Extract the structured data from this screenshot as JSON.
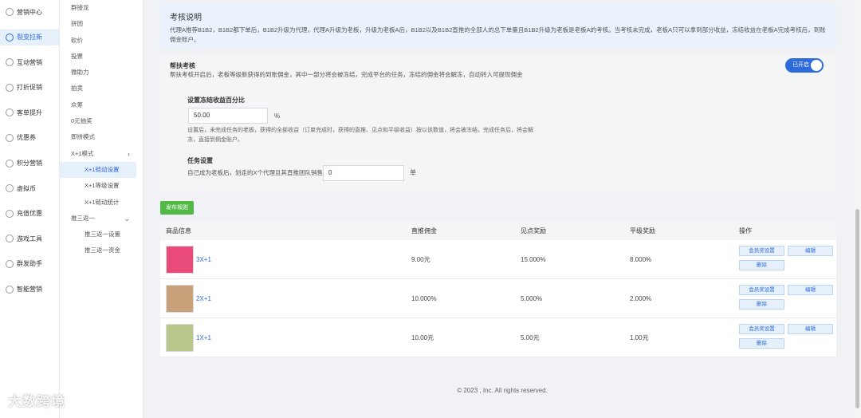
{
  "nav1": {
    "items": [
      {
        "label": "营销中心",
        "icon": "marketing-icon",
        "active": false
      },
      {
        "label": "裂变拉新",
        "icon": "fission-icon",
        "active": true
      },
      {
        "label": "互动营销",
        "icon": "interact-icon",
        "active": false
      },
      {
        "label": "打折促销",
        "icon": "discount-icon",
        "active": false
      },
      {
        "label": "客单提升",
        "icon": "orders-icon",
        "active": false
      },
      {
        "label": "优惠券",
        "icon": "coupon-icon",
        "active": false
      },
      {
        "label": "积分营销",
        "icon": "points-icon",
        "active": false
      },
      {
        "label": "虚拟币",
        "icon": "coin-icon",
        "active": false
      },
      {
        "label": "充值优惠",
        "icon": "recharge-icon",
        "active": false
      },
      {
        "label": "游戏工具",
        "icon": "game-icon",
        "active": false
      },
      {
        "label": "群发助手",
        "icon": "broadcast-icon",
        "active": false
      },
      {
        "label": "智能营销",
        "icon": "smart-icon",
        "active": false
      }
    ]
  },
  "nav2": {
    "items": [
      {
        "label": "群接龙"
      },
      {
        "label": "拼团"
      },
      {
        "label": "砍价"
      },
      {
        "label": "投票"
      },
      {
        "label": "微助力"
      },
      {
        "label": "拍卖"
      },
      {
        "label": "众筹"
      },
      {
        "label": "0元抽奖"
      },
      {
        "label": "即拼模式"
      }
    ],
    "group1": {
      "label": "X+1模式",
      "chevron": "›"
    },
    "group1_items": [
      {
        "label": "X+1链动设置",
        "active": true
      },
      {
        "label": "X+1等级设置",
        "active": false
      },
      {
        "label": "X+1链动统计",
        "active": false
      }
    ],
    "group2": {
      "label": "推三返一",
      "chevron": "⌄"
    },
    "group2_items": [
      {
        "label": "推三返一设置"
      },
      {
        "label": "推三返一资金"
      }
    ]
  },
  "explain": {
    "title": "考核说明",
    "desc": "代理A推荐B1B2，B1B2都下单后，B1B2升级为代理，代理A升级为老板，升级为老板A后，B1B2以及B1B2直推的全部人的总下单量且B1B2升级为老板是老板A的考核。当考核未完成，老板A只可以拿到部分收益，冻结收益在老板A完成考核后，到账佣金账户。"
  },
  "help": {
    "title": "帮扶考核",
    "desc": "帮扶考核开启后，老板等级新获得的到账佣金，其中一部分将会被冻结，完成平台的任务，冻结的佣金将会解冻，自动转入可提现佣金",
    "toggle_label": "已开启",
    "freeze_title": "设置冻结收益百分比",
    "freeze_value": "50.00",
    "freeze_unit": "%",
    "freeze_hint": "设置后，未完成任务的老板，获得的全部收益（订单完成时，获得的直推、见点和平级收益）按以该数值，将会被冻结，完成任务后，将会解冻，直接到佣金账户。",
    "task_title": "任务设置",
    "task_label": "自己成为老板后，划走的X个代理且其直推团队销售",
    "task_value": "0",
    "task_unit": "单"
  },
  "publish_label": "发布规则",
  "table": {
    "headers": [
      "商品信息",
      "直推佣金",
      "见点奖励",
      "平级奖励",
      "操作"
    ],
    "rows": [
      {
        "name": "3X+1",
        "direct": "9.00元",
        "point": "15.000%",
        "level": "8.000%",
        "thumb_color": "#e84a7a"
      },
      {
        "name": "2X+1",
        "direct": "10.000%",
        "point": "5.000%",
        "level": "2.000%",
        "thumb_color": "#c9a27c"
      },
      {
        "name": "1X+1",
        "direct": "10.00元",
        "point": "5.00元",
        "level": "1.00元",
        "thumb_color": "#b8c88a"
      }
    ],
    "btn_member": "会员奖设置",
    "btn_edit": "编辑",
    "btn_delete": "删除"
  },
  "footer": "© 2023 , Inc. All rights reserved.",
  "watermark": "大数跨境",
  "colors": {
    "accent": "#2d6bdc",
    "publish": "#52b947",
    "explain_bg": "#eaf3fd"
  }
}
